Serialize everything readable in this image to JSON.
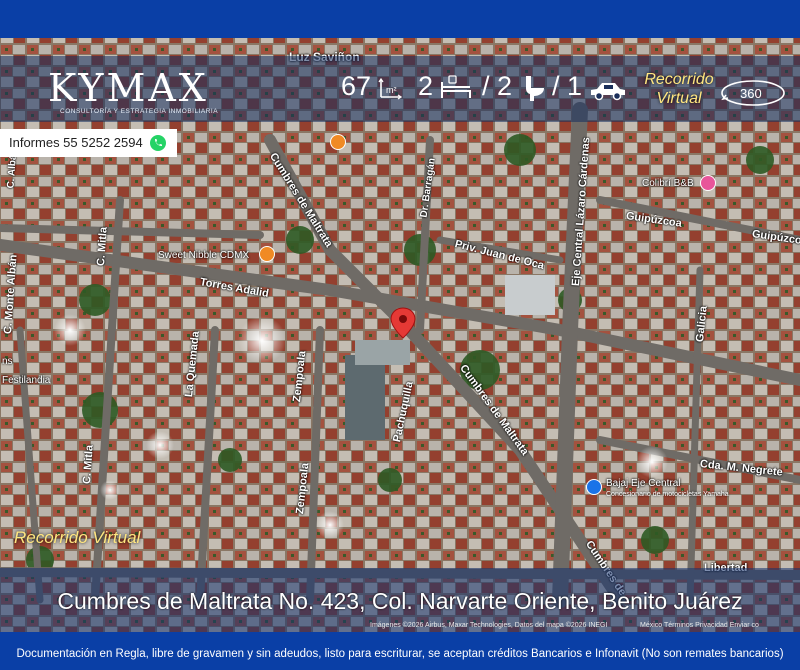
{
  "brand": {
    "name": "KYMAX",
    "tagline": "CONSULTORÍA Y ESTRATEGIA INMOBILIARIA"
  },
  "stats": {
    "area": "67",
    "bedrooms": "2",
    "bathrooms": "/ 2",
    "parking": "/ 1"
  },
  "icons": {
    "area": "area-m2-icon",
    "bed": "bed-icon",
    "toilet": "toilet-icon",
    "car": "car-icon",
    "whatsapp": "whatsapp-icon",
    "tour": "360-icon",
    "pin": "location-pin-icon"
  },
  "tour": {
    "top_label": "Recorrido Virtual",
    "button": "360",
    "bottom_label": "Recorrido Virtual"
  },
  "contact": {
    "text": "Informes 55 5252 2594"
  },
  "map": {
    "streets": [
      "Luz Saviñon",
      "Cumbres de Maltrata",
      "Dr. Barragán",
      "Priv. Juan de Oca",
      "Eje Central Lázaro Cárdenas",
      "Guipúzcoa",
      "Guipúzcoa",
      "Galicia",
      "Torres Adalid",
      "C. Mitla",
      "C. Mitla",
      "C. Monte Albán",
      "C. Albán",
      "La Quemada",
      "Zempoala",
      "Zempoala",
      "Pachuquilla",
      "Cumbres de Maltrata",
      "Cdа. M. Negrete",
      "Libertad",
      "Cumbres de"
    ],
    "pois": [
      "Colibrí B&B",
      "Sweet Nibble CDMX",
      "Bajaj Eje Central",
      "Festilandia",
      "ns"
    ],
    "poi_sub": "Concesionario de motocicletas Yamaha",
    "attribution": "Imágenes ©2026 Airbus, Maxar Technologies, Datos del mapa ©2026 INEGI",
    "links": "México   Términos   Privacidad   Enviar co"
  },
  "address": "Cumbres de Maltrata No. 423, Col. Narvarte Oriente, Benito Juárez",
  "footer": "Documentación en Regla, libre de gravamen y sin adeudos, listo para escriturar, se aceptan créditos Bancarios e Infonavit (No son remates bancarios)",
  "colors": {
    "brand_blue": "#0a3fa6",
    "pin_red": "#e53935",
    "poi_orange": "#f08a24",
    "poi_pink": "#e8559a",
    "poi_blue": "#1a73e8",
    "accent_yellow": "#ffe680"
  }
}
